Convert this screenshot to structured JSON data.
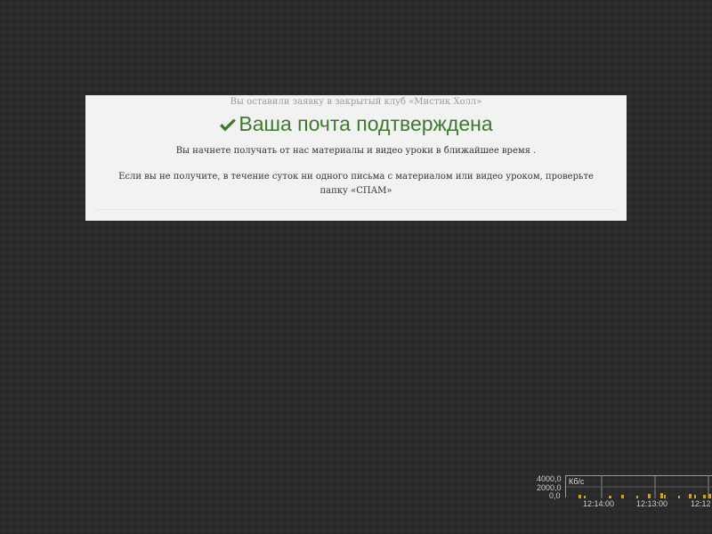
{
  "dialog": {
    "subtitle": "Вы оставили заявку в закрытый клуб «Мистик Холл»",
    "title": "Ваша почта подтверждена",
    "title_icon": "check-icon",
    "title_color": "#3d7a2a",
    "paragraph1": "Вы начнете получать от нас материалы и видео уроки в ближайшее время .",
    "paragraph2": "Если вы не получите, в течение суток ни одного письма с материалом или видео уроком, проверьте папку «СПАМ»"
  },
  "speed_monitor": {
    "unit": "Кб/с",
    "y_ticks": [
      "4000,0",
      "2000,0",
      "0,0"
    ],
    "time_labels": [
      "12:14:00",
      "12:13:00",
      "12:12"
    ],
    "bar_color": "#c9a227"
  }
}
